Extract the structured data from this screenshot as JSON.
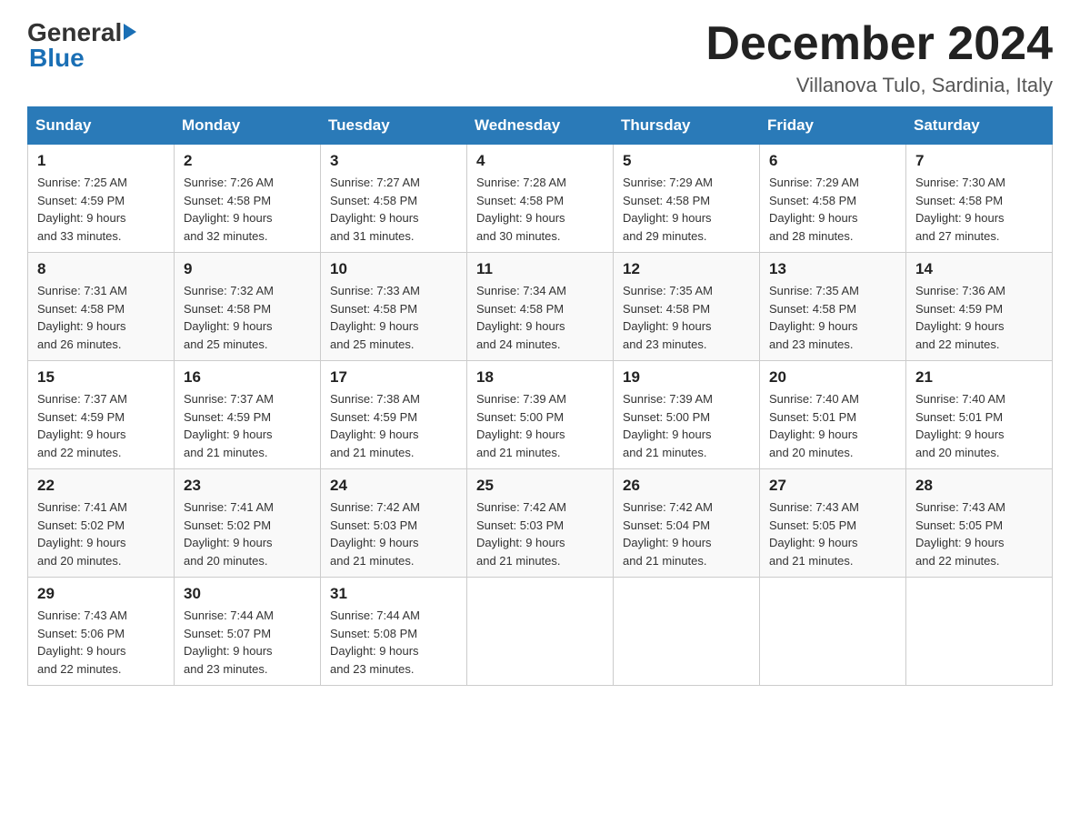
{
  "header": {
    "logo_general": "General",
    "logo_blue": "Blue",
    "month_title": "December 2024",
    "location": "Villanova Tulo, Sardinia, Italy"
  },
  "weekdays": [
    "Sunday",
    "Monday",
    "Tuesday",
    "Wednesday",
    "Thursday",
    "Friday",
    "Saturday"
  ],
  "weeks": [
    [
      {
        "day": "1",
        "sunrise": "7:25 AM",
        "sunset": "4:59 PM",
        "daylight": "9 hours and 33 minutes."
      },
      {
        "day": "2",
        "sunrise": "7:26 AM",
        "sunset": "4:58 PM",
        "daylight": "9 hours and 32 minutes."
      },
      {
        "day": "3",
        "sunrise": "7:27 AM",
        "sunset": "4:58 PM",
        "daylight": "9 hours and 31 minutes."
      },
      {
        "day": "4",
        "sunrise": "7:28 AM",
        "sunset": "4:58 PM",
        "daylight": "9 hours and 30 minutes."
      },
      {
        "day": "5",
        "sunrise": "7:29 AM",
        "sunset": "4:58 PM",
        "daylight": "9 hours and 29 minutes."
      },
      {
        "day": "6",
        "sunrise": "7:29 AM",
        "sunset": "4:58 PM",
        "daylight": "9 hours and 28 minutes."
      },
      {
        "day": "7",
        "sunrise": "7:30 AM",
        "sunset": "4:58 PM",
        "daylight": "9 hours and 27 minutes."
      }
    ],
    [
      {
        "day": "8",
        "sunrise": "7:31 AM",
        "sunset": "4:58 PM",
        "daylight": "9 hours and 26 minutes."
      },
      {
        "day": "9",
        "sunrise": "7:32 AM",
        "sunset": "4:58 PM",
        "daylight": "9 hours and 25 minutes."
      },
      {
        "day": "10",
        "sunrise": "7:33 AM",
        "sunset": "4:58 PM",
        "daylight": "9 hours and 25 minutes."
      },
      {
        "day": "11",
        "sunrise": "7:34 AM",
        "sunset": "4:58 PM",
        "daylight": "9 hours and 24 minutes."
      },
      {
        "day": "12",
        "sunrise": "7:35 AM",
        "sunset": "4:58 PM",
        "daylight": "9 hours and 23 minutes."
      },
      {
        "day": "13",
        "sunrise": "7:35 AM",
        "sunset": "4:58 PM",
        "daylight": "9 hours and 23 minutes."
      },
      {
        "day": "14",
        "sunrise": "7:36 AM",
        "sunset": "4:59 PM",
        "daylight": "9 hours and 22 minutes."
      }
    ],
    [
      {
        "day": "15",
        "sunrise": "7:37 AM",
        "sunset": "4:59 PM",
        "daylight": "9 hours and 22 minutes."
      },
      {
        "day": "16",
        "sunrise": "7:37 AM",
        "sunset": "4:59 PM",
        "daylight": "9 hours and 21 minutes."
      },
      {
        "day": "17",
        "sunrise": "7:38 AM",
        "sunset": "4:59 PM",
        "daylight": "9 hours and 21 minutes."
      },
      {
        "day": "18",
        "sunrise": "7:39 AM",
        "sunset": "5:00 PM",
        "daylight": "9 hours and 21 minutes."
      },
      {
        "day": "19",
        "sunrise": "7:39 AM",
        "sunset": "5:00 PM",
        "daylight": "9 hours and 21 minutes."
      },
      {
        "day": "20",
        "sunrise": "7:40 AM",
        "sunset": "5:01 PM",
        "daylight": "9 hours and 20 minutes."
      },
      {
        "day": "21",
        "sunrise": "7:40 AM",
        "sunset": "5:01 PM",
        "daylight": "9 hours and 20 minutes."
      }
    ],
    [
      {
        "day": "22",
        "sunrise": "7:41 AM",
        "sunset": "5:02 PM",
        "daylight": "9 hours and 20 minutes."
      },
      {
        "day": "23",
        "sunrise": "7:41 AM",
        "sunset": "5:02 PM",
        "daylight": "9 hours and 20 minutes."
      },
      {
        "day": "24",
        "sunrise": "7:42 AM",
        "sunset": "5:03 PM",
        "daylight": "9 hours and 21 minutes."
      },
      {
        "day": "25",
        "sunrise": "7:42 AM",
        "sunset": "5:03 PM",
        "daylight": "9 hours and 21 minutes."
      },
      {
        "day": "26",
        "sunrise": "7:42 AM",
        "sunset": "5:04 PM",
        "daylight": "9 hours and 21 minutes."
      },
      {
        "day": "27",
        "sunrise": "7:43 AM",
        "sunset": "5:05 PM",
        "daylight": "9 hours and 21 minutes."
      },
      {
        "day": "28",
        "sunrise": "7:43 AM",
        "sunset": "5:05 PM",
        "daylight": "9 hours and 22 minutes."
      }
    ],
    [
      {
        "day": "29",
        "sunrise": "7:43 AM",
        "sunset": "5:06 PM",
        "daylight": "9 hours and 22 minutes."
      },
      {
        "day": "30",
        "sunrise": "7:44 AM",
        "sunset": "5:07 PM",
        "daylight": "9 hours and 23 minutes."
      },
      {
        "day": "31",
        "sunrise": "7:44 AM",
        "sunset": "5:08 PM",
        "daylight": "9 hours and 23 minutes."
      },
      null,
      null,
      null,
      null
    ]
  ],
  "labels": {
    "sunrise": "Sunrise: ",
    "sunset": "Sunset: ",
    "daylight": "Daylight: "
  }
}
